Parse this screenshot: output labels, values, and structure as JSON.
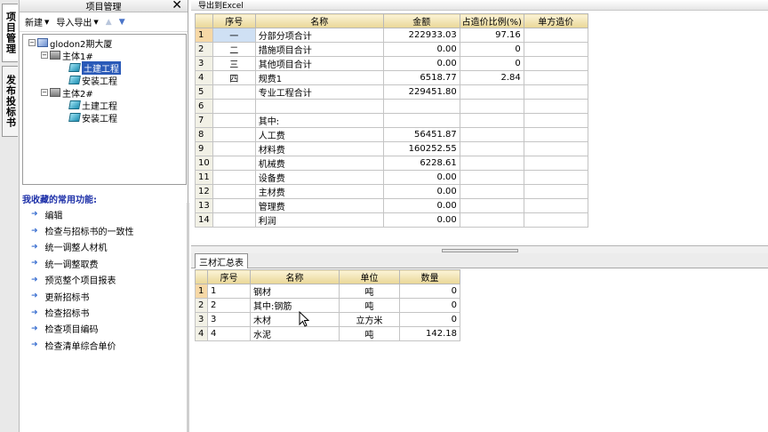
{
  "vtabs": {
    "project": "项目管理",
    "publish": "发布投标书"
  },
  "left": {
    "title": "项目管理",
    "toolbar": {
      "new": "新建",
      "import_export": "导入导出"
    },
    "tree": {
      "root": "glodon2期大厦",
      "body1": "主体1#",
      "body1_civil": "土建工程",
      "body1_install": "安装工程",
      "body2": "主体2#",
      "body2_civil": "土建工程",
      "body2_install": "安装工程"
    },
    "favorites_title": "我收藏的常用功能:",
    "favorites": [
      "编辑",
      "检查与招标书的一致性",
      "统一调整人材机",
      "统一调整取费",
      "预览整个项目报表",
      "更新招标书",
      "检查招标书",
      "检查项目编码",
      "检查清单综合单价"
    ]
  },
  "main": {
    "export_label": "导出到Excel",
    "grid1": {
      "headers": [
        "序号",
        "名称",
        "金额",
        "占造价比例(%)",
        "单方造价"
      ],
      "rows": [
        {
          "n": "1",
          "seq": "一",
          "name": "分部分项合计",
          "amount": "222933.03",
          "ratio": "97.16",
          "unit": ""
        },
        {
          "n": "2",
          "seq": "二",
          "name": "措施项目合计",
          "amount": "0.00",
          "ratio": "0",
          "unit": ""
        },
        {
          "n": "3",
          "seq": "三",
          "name": "其他项目合计",
          "amount": "0.00",
          "ratio": "0",
          "unit": ""
        },
        {
          "n": "4",
          "seq": "四",
          "name": "规费1",
          "amount": "6518.77",
          "ratio": "2.84",
          "unit": ""
        },
        {
          "n": "5",
          "seq": "",
          "name": "专业工程合计",
          "amount": "229451.80",
          "ratio": "",
          "unit": ""
        },
        {
          "n": "6",
          "seq": "",
          "name": "",
          "amount": "",
          "ratio": "",
          "unit": ""
        },
        {
          "n": "7",
          "seq": "",
          "name": "其中:",
          "amount": "",
          "ratio": "",
          "unit": ""
        },
        {
          "n": "8",
          "seq": "",
          "name": "人工费",
          "amount": "56451.87",
          "ratio": "",
          "unit": ""
        },
        {
          "n": "9",
          "seq": "",
          "name": "材料费",
          "amount": "160252.55",
          "ratio": "",
          "unit": ""
        },
        {
          "n": "10",
          "seq": "",
          "name": "机械费",
          "amount": "6228.61",
          "ratio": "",
          "unit": ""
        },
        {
          "n": "11",
          "seq": "",
          "name": "设备费",
          "amount": "0.00",
          "ratio": "",
          "unit": ""
        },
        {
          "n": "12",
          "seq": "",
          "name": "主材费",
          "amount": "0.00",
          "ratio": "",
          "unit": ""
        },
        {
          "n": "13",
          "seq": "",
          "name": "管理费",
          "amount": "0.00",
          "ratio": "",
          "unit": ""
        },
        {
          "n": "14",
          "seq": "",
          "name": "利润",
          "amount": "0.00",
          "ratio": "",
          "unit": ""
        }
      ]
    },
    "tab_label": "三材汇总表",
    "grid2": {
      "headers": [
        "序号",
        "名称",
        "单位",
        "数量"
      ],
      "rows": [
        {
          "n": "1",
          "seq": "1",
          "name": "钢材",
          "unit": "吨",
          "qty": "0"
        },
        {
          "n": "2",
          "seq": "2",
          "name": "其中:钢筋",
          "unit": "吨",
          "qty": "0"
        },
        {
          "n": "3",
          "seq": "3",
          "name": "木材",
          "unit": "立方米",
          "qty": "0"
        },
        {
          "n": "4",
          "seq": "4",
          "name": "水泥",
          "unit": "吨",
          "qty": "142.18"
        }
      ]
    }
  },
  "colors": {
    "header_gold": "#e9d796",
    "selection_blue": "#2a5ab8",
    "favorites_title": "#1c2fa8"
  }
}
